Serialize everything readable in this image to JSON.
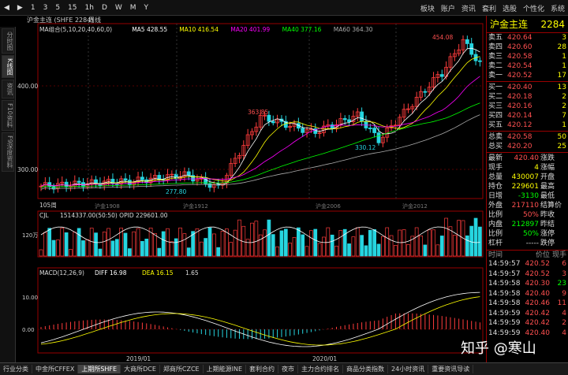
{
  "toolbar": {
    "items": [
      "◀",
      "▶",
      "1",
      "3",
      "5",
      "15",
      "1h",
      "D",
      "W",
      "M",
      "Y"
    ],
    "menu": [
      "板块",
      "账户",
      "资讯",
      "套利",
      "选股",
      "个性化",
      "系统"
    ]
  },
  "leftbar": {
    "tabs": [
      "分时图",
      "K线图",
      "资讯",
      "F10资料",
      "F9深度资料"
    ],
    "active": 1
  },
  "chart": {
    "header": {
      "name": "沪金主连 (SHFE 2284)",
      "period": "周线"
    },
    "ma_legend": [
      {
        "label": "MA组合(5,10,20,40,60,0)",
        "color": "#ddd"
      },
      {
        "label": "MA5 428.55",
        "color": "#fff"
      },
      {
        "label": "MA10 416.54",
        "color": "#ff0"
      },
      {
        "label": "MA20 401.99",
        "color": "#f0f"
      },
      {
        "label": "MA40 377.16",
        "color": "#0f0"
      },
      {
        "label": "MA60 364.30",
        "color": "#aaa"
      }
    ],
    "y_ticks": [
      "400.00",
      "300.00"
    ],
    "annotations": {
      "high": "454.08",
      "peak": "363.85",
      "low1": "277.80",
      "low2": "330.12",
      "start": "105周"
    },
    "period_labels": [
      "沪金1908",
      "沪金1912",
      "沪金2006",
      "沪金2012"
    ],
    "vol_header": "CJL",
    "vol_values": "1514337.00(50:50)  OPID 229601.00",
    "vol_tick": "120万",
    "macd_header": "MACD(12,26,9)",
    "macd_values": [
      {
        "label": "DIFF 16.98",
        "color": "#fff"
      },
      {
        "label": "DEA 16.15",
        "color": "#ff0"
      },
      {
        "label": "1.65",
        "color": "#ddd"
      }
    ],
    "macd_ticks": [
      "10.00",
      "0.00"
    ],
    "x_labels": [
      "2019/01",
      "2020/01"
    ]
  },
  "quote": {
    "name": "沪金主连",
    "code": "2284",
    "asks": [
      {
        "label": "卖五",
        "price": "420.64",
        "vol": "3"
      },
      {
        "label": "卖四",
        "price": "420.60",
        "vol": "28"
      },
      {
        "label": "卖三",
        "price": "420.58",
        "vol": "1"
      },
      {
        "label": "卖二",
        "price": "420.54",
        "vol": "1"
      },
      {
        "label": "卖一",
        "price": "420.52",
        "vol": "17"
      }
    ],
    "bids": [
      {
        "label": "买一",
        "price": "420.40",
        "vol": "13"
      },
      {
        "label": "买二",
        "price": "420.18",
        "vol": "2"
      },
      {
        "label": "买三",
        "price": "420.16",
        "vol": "2"
      },
      {
        "label": "买四",
        "price": "420.14",
        "vol": "7"
      },
      {
        "label": "买五",
        "price": "420.12",
        "vol": "1"
      }
    ],
    "totals": [
      {
        "label": "总卖",
        "price": "420.58",
        "vol": "50"
      },
      {
        "label": "总买",
        "price": "420.20",
        "vol": "25"
      }
    ],
    "stats": [
      {
        "k": "最新",
        "v": "420.40",
        "vc": "#ff5050",
        "k2": "涨跌",
        "v2": ""
      },
      {
        "k": "现手",
        "v": "4",
        "vc": "#ff0",
        "k2": "涨幅",
        "v2": ""
      },
      {
        "k": "总量",
        "v": "430007",
        "vc": "#ff0",
        "k2": "开盘",
        "v2": ""
      },
      {
        "k": "持仓",
        "v": "229601",
        "vc": "#ff0",
        "k2": "最高",
        "v2": ""
      },
      {
        "k": "日增",
        "v": "-3130",
        "vc": "#0f0",
        "k2": "最低",
        "v2": ""
      },
      {
        "k": "外盘",
        "v": "217110",
        "vc": "#ff5050",
        "k2": "结算价",
        "v2": ""
      },
      {
        "k": "比例",
        "v": "50%",
        "vc": "#ff5050",
        "k2": "昨收",
        "v2": ""
      },
      {
        "k": "内盘",
        "v": "212897",
        "vc": "#0f0",
        "k2": "昨结",
        "v2": ""
      },
      {
        "k": "比例",
        "v": "50%",
        "vc": "#0f0",
        "k2": "涨停",
        "v2": ""
      },
      {
        "k": "杠杆",
        "v": "-----",
        "vc": "#ddd",
        "k2": "跌停",
        "v2": ""
      }
    ],
    "trades_head": [
      "时间",
      "价位",
      "现手"
    ],
    "trades": [
      {
        "t": "14:59:57",
        "p": "420.52",
        "q": "6",
        "qc": "#ff5050"
      },
      {
        "t": "14:59:57",
        "p": "420.52",
        "q": "3",
        "qc": "#ff5050"
      },
      {
        "t": "14:59:58",
        "p": "420.30",
        "q": "23",
        "qc": "#0f0"
      },
      {
        "t": "14:59:58",
        "p": "420.40",
        "q": "9",
        "qc": "#ff5050"
      },
      {
        "t": "14:59:58",
        "p": "420.46",
        "q": "11",
        "qc": "#ff5050"
      },
      {
        "t": "14:59:59",
        "p": "420.42",
        "q": "4",
        "qc": "#ff5050"
      },
      {
        "t": "14:59:59",
        "p": "420.42",
        "q": "2",
        "qc": "#ff5050"
      },
      {
        "t": "14:59:59",
        "p": "420.40",
        "q": "4",
        "qc": "#ff5050"
      }
    ]
  },
  "bottom_tabs": [
    "行业分类",
    "中金所CFFEX",
    "上期所SHFE",
    "大商所DCE",
    "郑商所CZCE",
    "上期能源INE",
    "套利合约",
    "夜市",
    "主力合约排名",
    "商品分类指数",
    "24小时资讯",
    "重要资讯导读"
  ],
  "bottom_active": 2,
  "watermark": "知乎 @寒山"
}
